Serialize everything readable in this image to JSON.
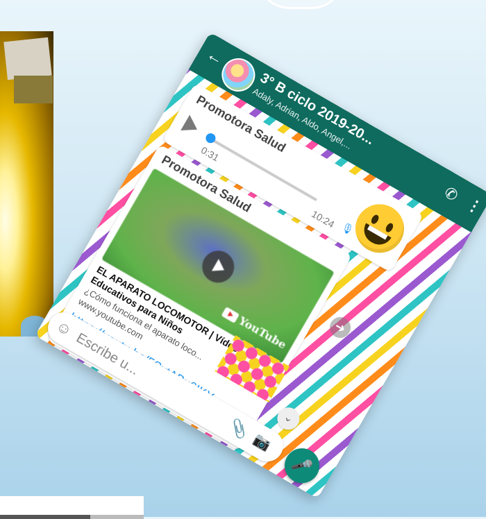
{
  "header": {
    "back_icon": "arrow-left-icon",
    "group_title": "3° B ciclo 2019-20...",
    "group_members": "Adaly, Adrian, Aldo, Angel,...",
    "call_icon": "add-call-icon",
    "menu_icon": "more-vert-icon"
  },
  "messages": {
    "audio": {
      "sender": "Promotora Salud",
      "duration": "0:31",
      "time": "10:24"
    },
    "link": {
      "sender": "Promotora Salud",
      "preview_title": "EL APARATO LOCOMOTOR | Vídeos Educativos para Niños",
      "preview_description": "¿Cómo funciona el aparato loco...",
      "preview_domain": "www.youtube.com",
      "url": "https://youtu.be/5SytABu6IKY",
      "time": "10:24",
      "youtube_label": "YouTube"
    }
  },
  "input": {
    "placeholder": "Escribe u..."
  },
  "colors": {
    "appbar": "#0e6b5e",
    "link": "#2196f3",
    "mic_button": "#0e8a78"
  }
}
